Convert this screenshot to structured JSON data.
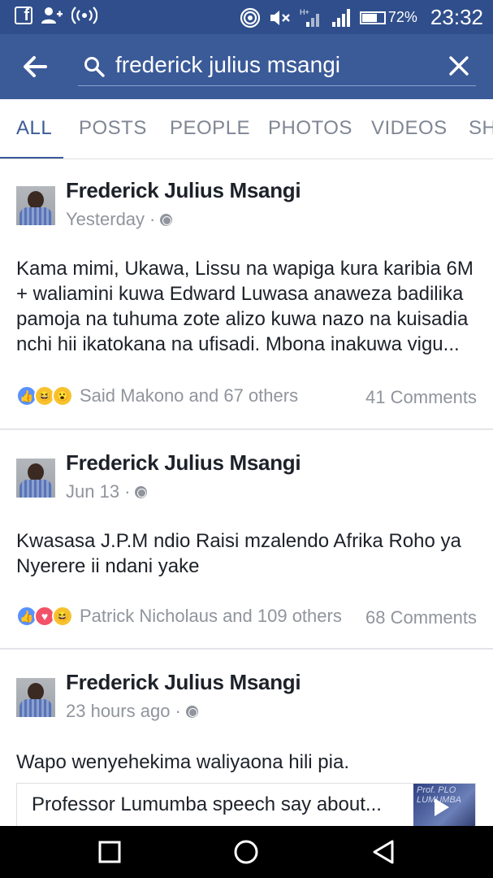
{
  "status_bar": {
    "battery_percent_label": "72%",
    "battery_level": 0.72,
    "time": "23:32",
    "icons": [
      "facebook-icon",
      "friend-request-icon",
      "broadcast-icon",
      "hotspot-icon",
      "mute-icon",
      "data-signal-icon",
      "cell-signal-icon",
      "battery-icon"
    ]
  },
  "search": {
    "query": "frederick julius msangi"
  },
  "tabs": [
    {
      "label": "ALL",
      "active": true
    },
    {
      "label": "POSTS",
      "active": false
    },
    {
      "label": "PEOPLE",
      "active": false
    },
    {
      "label": "PHOTOS",
      "active": false
    },
    {
      "label": "VIDEOS",
      "active": false
    },
    {
      "label": "SHO",
      "active": false
    }
  ],
  "posts": [
    {
      "author": "Frederick Julius Msangi",
      "time": "Yesterday",
      "separator": "·",
      "text": "Kama mimi, Ukawa, Lissu na wapiga kura karibia 6M + waliamini kuwa Edward Luwasa anaweza badilika pamoja na tuhuma zote alizo kuwa nazo na kuisadia nchi hii ikatokana na ufisadi. Mbona inakuwa vigu...",
      "reactions": [
        "like",
        "haha",
        "wow"
      ],
      "reaction_summary": "Said Makono and 67 others",
      "comments": "41 Comments"
    },
    {
      "author": "Frederick Julius Msangi",
      "time": "Jun 13",
      "separator": "·",
      "text": "Kwasasa J.P.M ndio Raisi mzalendo Afrika Roho ya Nyerere ii ndani yake",
      "reactions": [
        "like",
        "love",
        "haha"
      ],
      "reaction_summary": "Patrick Nicholaus and 109 others",
      "comments": "68 Comments"
    },
    {
      "author": "Frederick Julius Msangi",
      "time": "23 hours ago",
      "separator": "·",
      "text": "Wapo wenyehekima waliyaona hili pia.",
      "link_title": "Professor Lumumba speech say about...",
      "link_thumb_text": "Prof. PLO LUMUMBA"
    }
  ],
  "colors": {
    "status_bar": "#2f4e8b",
    "header": "#3b5a98",
    "accent": "#3b5a98",
    "muted_text": "#90949c"
  }
}
